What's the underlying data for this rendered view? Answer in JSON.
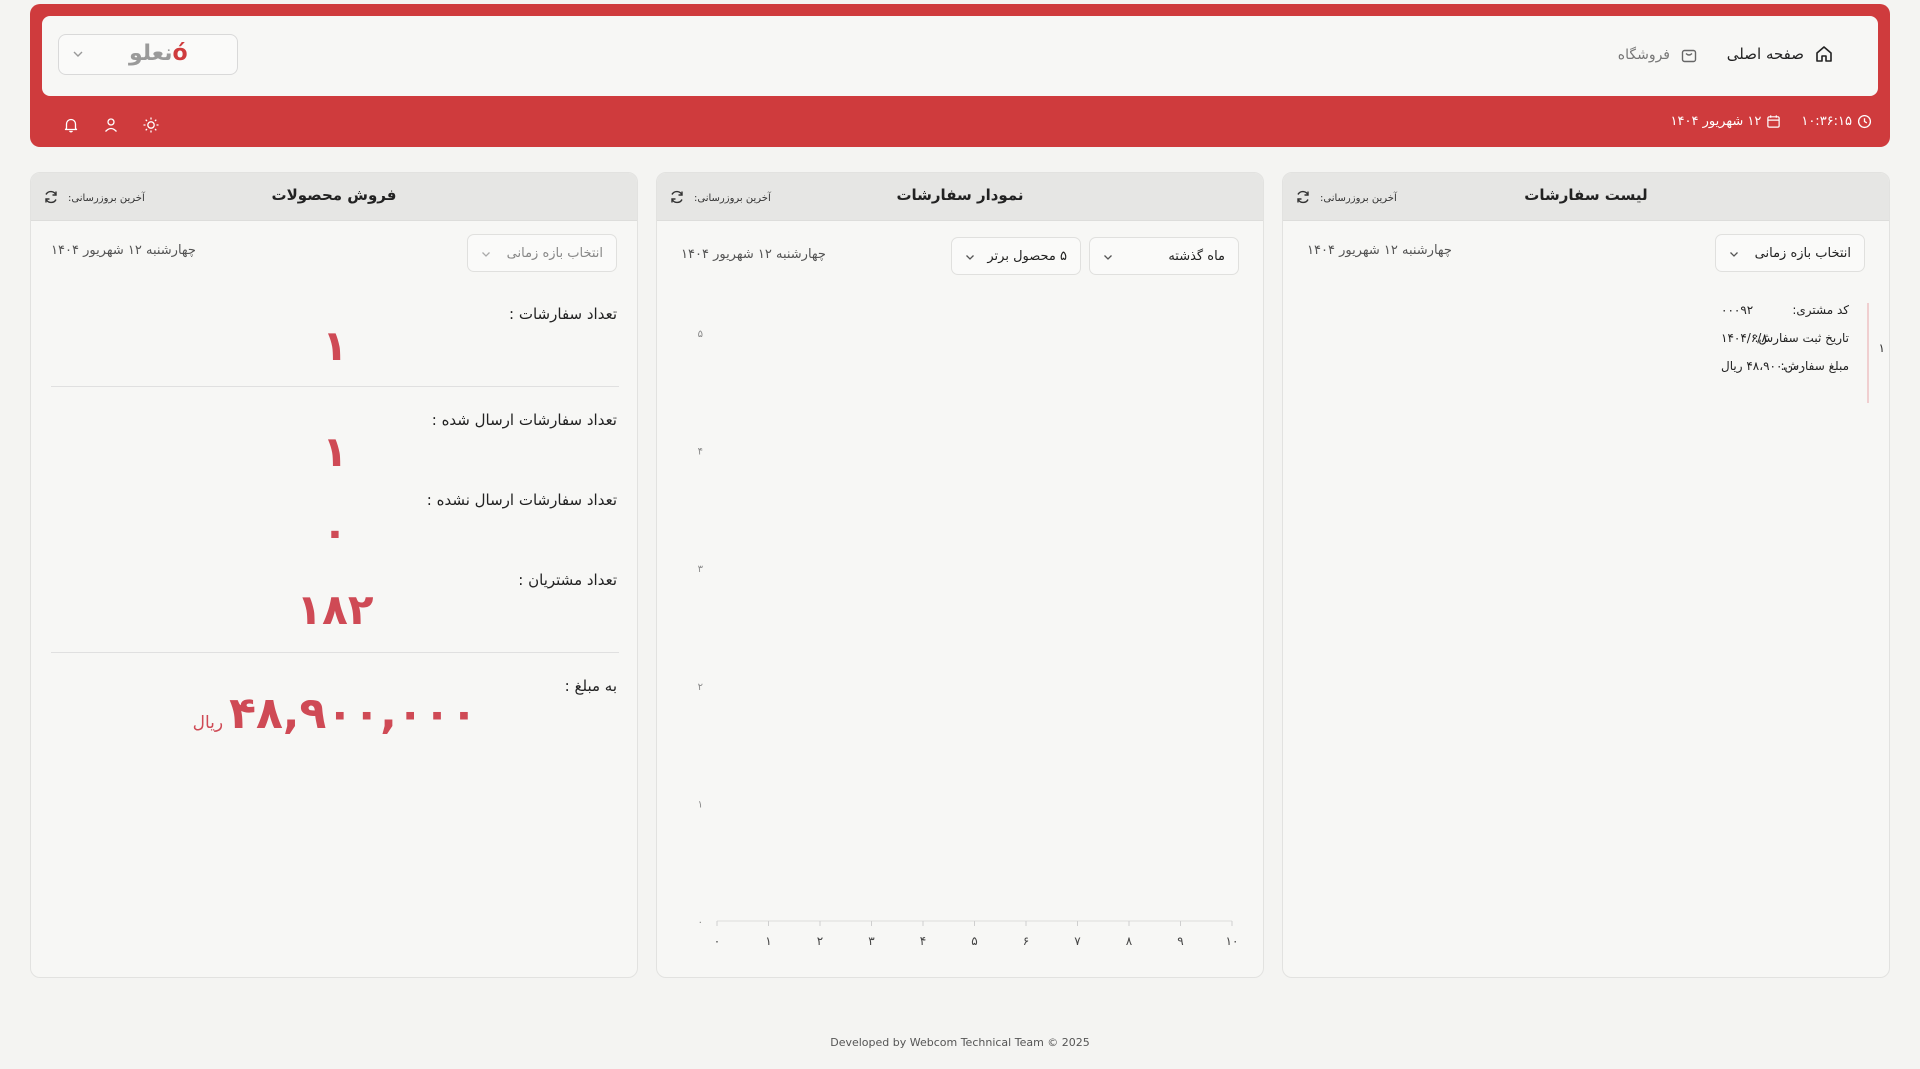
{
  "header": {
    "logo": "نعلو",
    "nav_home": "صفحه اصلی",
    "nav_shop": "فروشگاه",
    "time": "۱۰:۳۶:۱۵",
    "date": "۱۲ شهریور ۱۴۰۴",
    "icons": {
      "home": "home-icon",
      "shop": "shopping-bag-icon",
      "clock": "clock-icon",
      "calendar": "calendar-icon",
      "bell": "bell-icon",
      "user": "user-icon",
      "theme": "sun-icon"
    },
    "accent_color": "#cf3b3d"
  },
  "order_list": {
    "title": "لیست سفارشات",
    "last_update": "آخرین بروزرسانی:",
    "range_select": "انتخاب بازه زمانی",
    "date": "چهارشنبه ۱۲ شهریور ۱۴۰۴",
    "orders": [
      {
        "index": "۱",
        "customer_code_label": "کد مشتری:",
        "customer_code": "۰۰۰۹۲",
        "order_date_label": "تاریخ ثبت سفارش:",
        "order_date": "۱۴۰۴/۶/۸",
        "amount_label": "مبلغ سفارش:",
        "amount": "۴۸،۹۰۰،۰۰۰ ریال"
      }
    ]
  },
  "order_chart": {
    "title": "نمودار سفارشات",
    "last_update": "آخرین بروزرسانی:",
    "period_select": "ماه گذشته",
    "top_select": "۵ محصول برتر",
    "date": "چهارشنبه ۱۲ شهریور ۱۴۰۴"
  },
  "chart_data": {
    "type": "bar",
    "x_ticks": [
      "۰",
      "۱",
      "۲",
      "۳",
      "۴",
      "۵",
      "۶",
      "۷",
      "۸",
      "۹",
      "۱۰"
    ],
    "y_ticks": [
      "۰",
      "۱",
      "۲",
      "۳",
      "۴",
      "۵"
    ],
    "xlim": [
      0,
      10
    ],
    "ylim": [
      0,
      5
    ],
    "series": [],
    "grid": false
  },
  "product_sales": {
    "title": "فروش محصولات",
    "last_update": "آخرین بروزرسانی:",
    "range_select": "انتخاب بازه زمانی",
    "date": "چهارشنبه ۱۲ شهریور ۱۴۰۴",
    "orders_count_label": "تعداد سفارشات :",
    "orders_count": "۱",
    "sent_label": "تعداد سفارشات ارسال شده :",
    "sent": "۱",
    "unsent_label": "تعداد سفارشات ارسال نشده :",
    "unsent": "۰",
    "customers_label": "تعداد مشتریان :",
    "customers": "۱۸۲",
    "amount_label": "به مبلغ :",
    "amount": "۴۸,۹۰۰,۰۰۰",
    "currency": "ریال"
  },
  "footer": "Developed by Webcom Technical Team © 2025"
}
